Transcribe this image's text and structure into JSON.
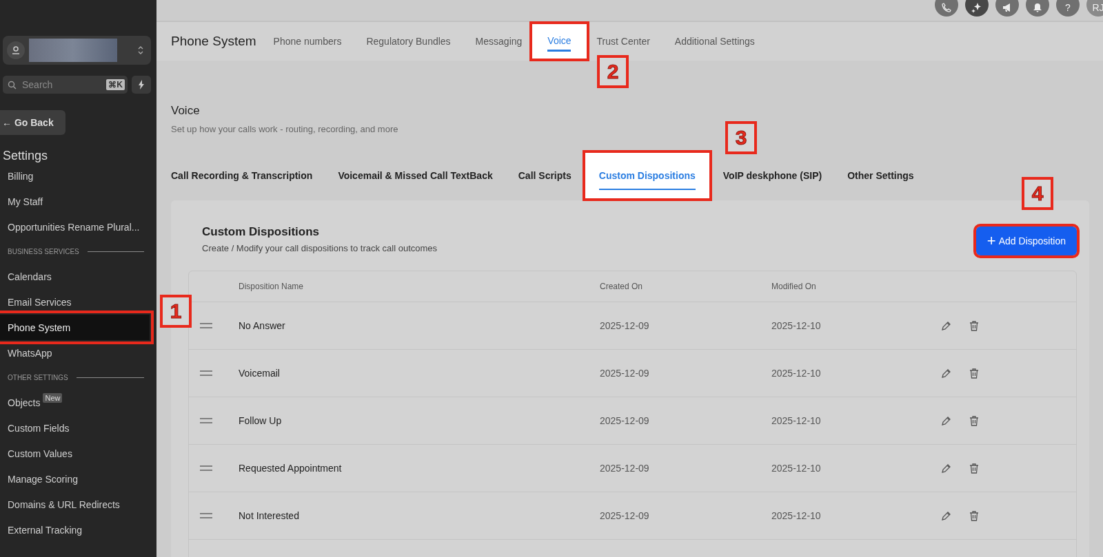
{
  "topbar": {
    "icons": [
      {
        "kind": "phone"
      },
      {
        "kind": "sparkle"
      },
      {
        "kind": "megaphone"
      },
      {
        "kind": "bell"
      },
      {
        "kind": "text",
        "label": "?"
      },
      {
        "kind": "avatar",
        "label": "RJ"
      }
    ]
  },
  "sidebar": {
    "search": {
      "placeholder": "Search",
      "shortcut": "⌘K"
    },
    "back_icon": "←",
    "back": "Go Back",
    "heading": "Settings",
    "items": [
      {
        "kind": "item",
        "label": "Billing",
        "selected": false,
        "annotated": false
      },
      {
        "kind": "item",
        "label": "My Staff",
        "selected": false,
        "annotated": false
      },
      {
        "kind": "item",
        "label": "Opportunities Rename Plural...",
        "selected": false,
        "annotated": false
      },
      {
        "kind": "section",
        "label": "BUSINESS SERVICES"
      },
      {
        "kind": "item",
        "label": "Calendars",
        "selected": false,
        "annotated": false
      },
      {
        "kind": "item",
        "label": "Email Services",
        "selected": false,
        "annotated": false
      },
      {
        "kind": "item",
        "label": "Phone System",
        "selected": true,
        "annotated": true
      },
      {
        "kind": "item",
        "label": "WhatsApp",
        "selected": false,
        "annotated": false
      },
      {
        "kind": "section",
        "label": "OTHER SETTINGS"
      },
      {
        "kind": "item",
        "label": "Objects",
        "badge": "New",
        "selected": false,
        "annotated": false
      },
      {
        "kind": "item",
        "label": "Custom Fields",
        "selected": false,
        "annotated": false
      },
      {
        "kind": "item",
        "label": "Custom Values",
        "selected": false,
        "annotated": false
      },
      {
        "kind": "item",
        "label": "Manage Scoring",
        "selected": false,
        "annotated": false
      },
      {
        "kind": "item",
        "label": "Domains & URL Redirects",
        "selected": false,
        "annotated": false
      },
      {
        "kind": "item",
        "label": "External Tracking",
        "selected": false,
        "annotated": false
      }
    ]
  },
  "header": {
    "title": "Phone System",
    "tabs": [
      {
        "label": "Phone numbers",
        "selected": false,
        "annotated": false
      },
      {
        "label": "Regulatory Bundles",
        "selected": false,
        "annotated": false
      },
      {
        "label": "Messaging",
        "selected": false,
        "annotated": false
      },
      {
        "label": "Voice",
        "selected": true,
        "annotated": true
      },
      {
        "label": "Trust Center",
        "selected": false,
        "annotated": false
      },
      {
        "label": "Additional Settings",
        "selected": false,
        "annotated": false
      }
    ]
  },
  "page": {
    "title": "Voice",
    "subtitle": "Set up how your calls work - routing, recording, and more",
    "tabs": [
      {
        "label": "Call Recording & Transcription",
        "selected": false,
        "annotated": false
      },
      {
        "label": "Voicemail & Missed Call TextBack",
        "selected": false,
        "annotated": false
      },
      {
        "label": "Call Scripts",
        "selected": false,
        "annotated": false
      },
      {
        "label": "Custom Dispositions",
        "selected": true,
        "annotated": true
      },
      {
        "label": "VoIP deskphone (SIP)",
        "selected": false,
        "annotated": false
      },
      {
        "label": "Other Settings",
        "selected": false,
        "annotated": false
      }
    ]
  },
  "card": {
    "title": "Custom Dispositions",
    "subtitle": "Create / Modify your call dispositions to track call outcomes",
    "button": {
      "icon": "+",
      "label": "Add Disposition",
      "annotated": true
    },
    "table": {
      "columns": [
        "Disposition Name",
        "Created On",
        "Modified On"
      ],
      "rows": [
        {
          "name": "No Answer",
          "created": "2025-12-09",
          "modified": "2025-12-10"
        },
        {
          "name": "Voicemail",
          "created": "2025-12-09",
          "modified": "2025-12-10"
        },
        {
          "name": "Follow Up",
          "created": "2025-12-09",
          "modified": "2025-12-10"
        },
        {
          "name": "Requested Appointment",
          "created": "2025-12-09",
          "modified": "2025-12-10"
        },
        {
          "name": "Not Interested",
          "created": "2025-12-09",
          "modified": "2025-12-10"
        }
      ]
    }
  },
  "callouts": [
    {
      "label": "1"
    },
    {
      "label": "2"
    },
    {
      "label": "3"
    },
    {
      "label": "4"
    }
  ]
}
